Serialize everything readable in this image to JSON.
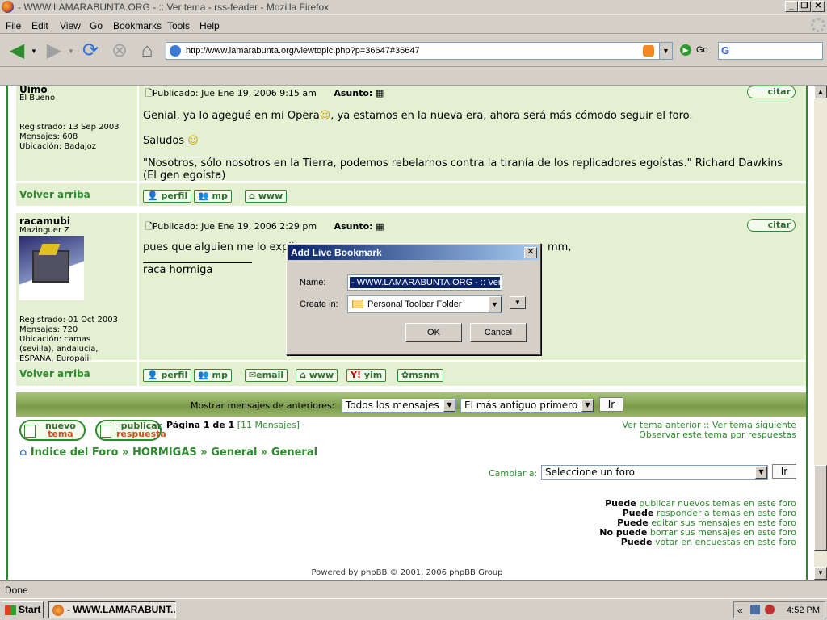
{
  "window": {
    "title": "- WWW.LAMARABUNTA.ORG - :: Ver tema - rss-feader - Mozilla Firefox",
    "min": "_",
    "max": "❐",
    "close": "✕"
  },
  "menu": [
    "File",
    "Edit",
    "View",
    "Go",
    "Bookmarks",
    "Tools",
    "Help"
  ],
  "navbar": {
    "url": "http://www.lamarabunta.org/viewtopic.php?p=36647#36647",
    "go_label": "Go",
    "search_engine": "G"
  },
  "posts": [
    {
      "author": "Uimo",
      "rank": "El Bueno",
      "registered": "Registrado: 13 Sep 2003",
      "messages": "Mensajes: 608",
      "location": "Ubicación: Badajoz",
      "posted": "Publicado: Jue Ene 19, 2006 9:15 am",
      "subject_label": "Asunto:",
      "body_lines": [
        "Genial, ya lo agegué en mi Opera",
        ", ya estamos en la nueva era, ahora será más cómodo seguir el foro.",
        "Saludos"
      ],
      "signature": "\"Nosotros, sólo nosotros en la Tierra, podemos rebelarnos contra la tiranía de los replicadores egoístas.\" Richard Dawkins (El gen egoísta)",
      "buttons": [
        "perfil",
        "mp",
        "www"
      ]
    },
    {
      "author": "racamubi",
      "rank": "Mazinguer Z",
      "registered": "Registrado: 01 Oct 2003",
      "messages": "Mensajes: 720",
      "location": "Ubicación: camas (sevilla), andalucia, ESPAÑA, Europaiii",
      "posted": "Publicado: Jue Ene 19, 2006 2:29 pm",
      "subject_label": "Asunto:",
      "body_lines": [
        "pues que alguien me lo expli",
        "mm,"
      ],
      "signature": "raca hormiga",
      "buttons": [
        "perfil",
        "mp",
        "email",
        "www",
        "yim",
        "msnm"
      ]
    }
  ],
  "citar": "citar",
  "volver": "Volver arriba",
  "filter": {
    "label": "Mostrar mensajes de anteriores:",
    "range": "Todos los mensajes",
    "order": "El más antiguo primero",
    "go": "Ir"
  },
  "bottom": {
    "new_topic": [
      "nuevo",
      "tema"
    ],
    "reply": [
      "publicar",
      "respuesta"
    ],
    "page_info": "Página 1 de 1",
    "msg_count": "[11 Mensajes]",
    "prev_next": "Ver tema anterior :: Ver tema siguiente",
    "watch": "Observar este tema por respuestas",
    "breadcrumb": [
      "Indice del Foro",
      "HORMIGAS",
      "General",
      "General"
    ],
    "jump_label": "Cambiar a:",
    "jump_select": "Seleccione un foro",
    "jump_go": "Ir",
    "perms": [
      {
        "b": "Puede",
        "t": "publicar nuevos temas en este foro"
      },
      {
        "b": "Puede",
        "t": "responder a temas en este foro"
      },
      {
        "b": "Puede",
        "t": "editar sus mensajes en este foro"
      },
      {
        "b": "No puede",
        "t": "borrar sus mensajes en este foro"
      },
      {
        "b": "Puede",
        "t": "votar en encuestas en este foro"
      }
    ],
    "powered": "Powered by phpBB © 2001, 2006 phpBB Group"
  },
  "dialog": {
    "title": "Add Live Bookmark",
    "name_label": "Name:",
    "name_value": "- WWW.LAMARABUNTA.ORG - :: Ver t",
    "create_label": "Create in:",
    "create_value": "Personal Toolbar Folder",
    "ok": "OK",
    "cancel": "Cancel"
  },
  "status": "Done",
  "taskbar": {
    "start": "Start",
    "task": "- WWW.LAMARABUNT...",
    "clock": "4:52 PM"
  },
  "colors": {
    "accent": "#2e8b2e",
    "post_bg": "#e3f0d2",
    "dialog_caption": "#0a246a"
  }
}
